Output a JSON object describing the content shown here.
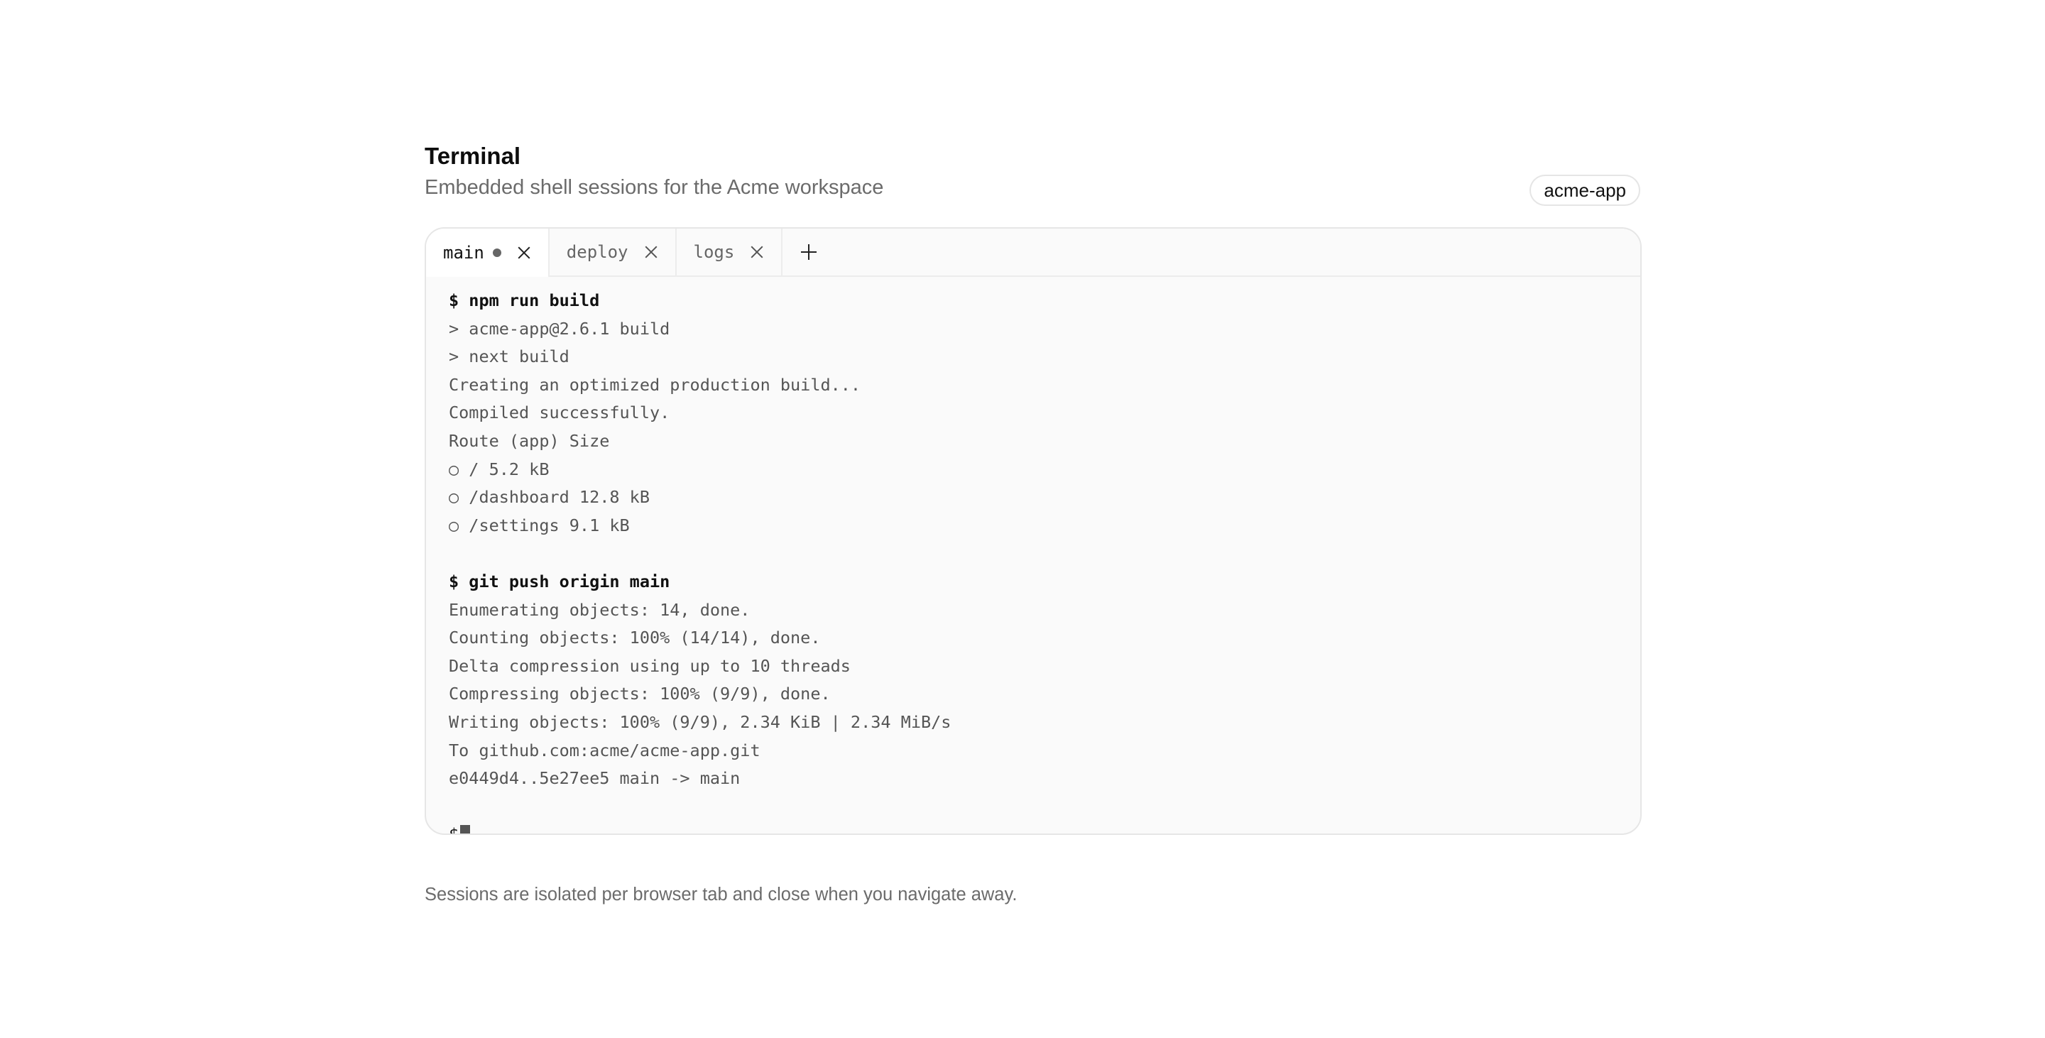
{
  "header": {
    "title": "Terminal",
    "subtitle": "Embedded shell sessions for the Acme workspace",
    "workspace_badge": "acme-app"
  },
  "tabs": [
    {
      "label": "main",
      "active": true,
      "has_activity": true
    },
    {
      "label": "deploy",
      "active": false,
      "has_activity": false
    },
    {
      "label": "logs",
      "active": false,
      "has_activity": false
    }
  ],
  "terminal": {
    "lines": [
      {
        "kind": "cmd",
        "text": "$ npm run build"
      },
      {
        "kind": "out",
        "text": "> acme-app@2.6.1 build"
      },
      {
        "kind": "out",
        "text": "> next build"
      },
      {
        "kind": "out",
        "text": "Creating an optimized production build..."
      },
      {
        "kind": "out",
        "text": "Compiled successfully."
      },
      {
        "kind": "out",
        "text": "Route (app) Size"
      },
      {
        "kind": "out",
        "text": "○ / 5.2 kB"
      },
      {
        "kind": "out",
        "text": "○ /dashboard 12.8 kB"
      },
      {
        "kind": "out",
        "text": "○ /settings 9.1 kB"
      },
      {
        "kind": "blank",
        "text": ""
      },
      {
        "kind": "cmd",
        "text": "$ git push origin main"
      },
      {
        "kind": "out",
        "text": "Enumerating objects: 14, done."
      },
      {
        "kind": "out",
        "text": "Counting objects: 100% (14/14), done."
      },
      {
        "kind": "out",
        "text": "Delta compression using up to 10 threads"
      },
      {
        "kind": "out",
        "text": "Compressing objects: 100% (9/9), done."
      },
      {
        "kind": "out",
        "text": "Writing objects: 100% (9/9), 2.34 KiB | 2.34 MiB/s"
      },
      {
        "kind": "out",
        "text": "To github.com:acme/acme-app.git"
      },
      {
        "kind": "out",
        "text": "e0449d4..5e27ee5 main -> main"
      },
      {
        "kind": "blank",
        "text": ""
      }
    ],
    "prompt": "$"
  },
  "footer": {
    "note": "Sessions are isolated per browser tab and close when you navigate away."
  },
  "colors": {
    "panel_bg": "#fafafa",
    "border": "#e6e6e6",
    "muted_text": "#6b6b6b",
    "cursor": "#555555"
  }
}
